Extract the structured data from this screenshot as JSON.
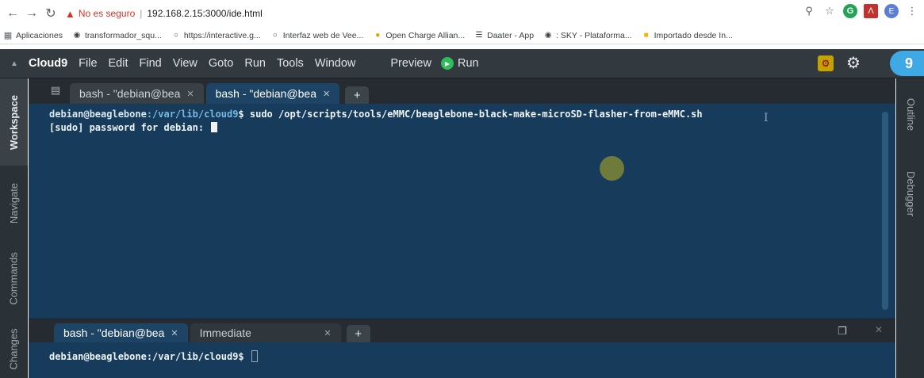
{
  "browser": {
    "not_secure": "No es seguro",
    "url": "192.168.2.15:3000/ide.html",
    "bookmarks": [
      "Aplicaciones",
      "transformador_squ...",
      "https://interactive.g...",
      "Interfaz web de Vee...",
      "Open Charge Allian...",
      "Daater - App",
      ": SKY - Plataforma...",
      "Importado desde In..."
    ],
    "profile_initial": "E"
  },
  "menubar": {
    "brand": "Cloud9",
    "items": [
      "File",
      "Edit",
      "Find",
      "View",
      "Goto",
      "Run",
      "Tools",
      "Window"
    ],
    "preview": "Preview",
    "run": "Run"
  },
  "left_rail": [
    "Workspace",
    "Navigate",
    "Commands",
    "Changes"
  ],
  "right_rail": [
    "Outline",
    "Debugger"
  ],
  "top_tabs": [
    {
      "label": "bash - \"debian@bea",
      "active": false
    },
    {
      "label": "bash - \"debian@bea",
      "active": true
    }
  ],
  "bottom_tabs": [
    {
      "label": "bash - \"debian@bea",
      "active": true
    },
    {
      "label": "Immediate",
      "active": false
    }
  ],
  "terminal_top": {
    "prompt_user": "debian@beaglebone",
    "prompt_path": ":/var/lib/cloud9",
    "prompt_symbol": "$",
    "command": " sudo /opt/scripts/tools/eMMC/beaglebone-black-make-microSD-flasher-from-eMMC.sh",
    "line2": "[sudo] password for debian: "
  },
  "terminal_bottom": {
    "prompt": "debian@beaglebone:/var/lib/cloud9$ "
  },
  "colors": {
    "menubar_bg": "#32393f",
    "terminal_bg": "#173c5b",
    "active_tab_bg": "#1d4464",
    "run_green": "#2ebd58",
    "c9_blue": "#3fa9e6"
  }
}
